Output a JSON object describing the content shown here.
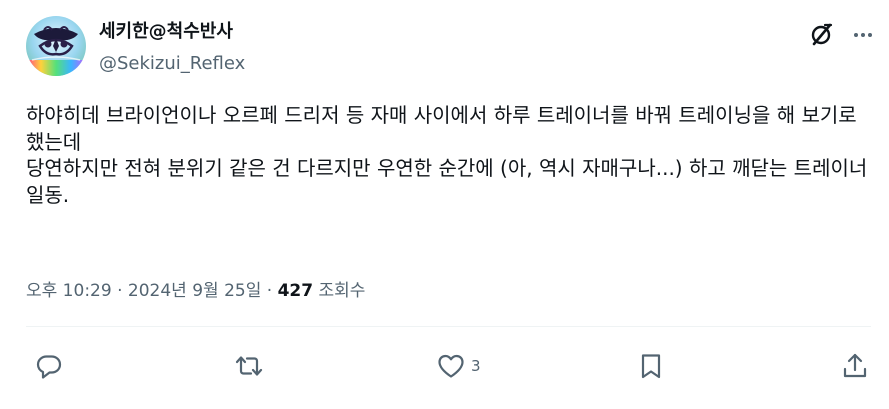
{
  "author": {
    "display_name": "세키한@척수반사",
    "handle": "@Sekizui_Reflex",
    "avatar_icon": "ornate-avatar-image"
  },
  "header_actions": {
    "grok_icon": "grok-icon",
    "more_icon": "more-horizontal-icon"
  },
  "tweet": {
    "text": "하야히데 브라이언이나 오르페 드리저 등 자매 사이에서 하루 트레이너를 바꿔 트레이닝을 해 보기로 했는데\n당연하지만 전혀 분위기 같은 건 다르지만 우연한 순간에 (아, 역시 자매구나...) 하고 깨닫는 트레이너 일동."
  },
  "meta": {
    "time": "오후 10:29",
    "separator": "·",
    "date": "2024년 9월 25일",
    "views_count": "427",
    "views_label": "조회수"
  },
  "actions": {
    "reply_icon": "reply-icon",
    "retweet_icon": "retweet-icon",
    "like_icon": "heart-icon",
    "like_count": "3",
    "bookmark_icon": "bookmark-icon",
    "share_icon": "share-icon"
  },
  "colors": {
    "text_primary": "#0f1419",
    "text_secondary": "#536471",
    "divider": "#eff3f4"
  }
}
